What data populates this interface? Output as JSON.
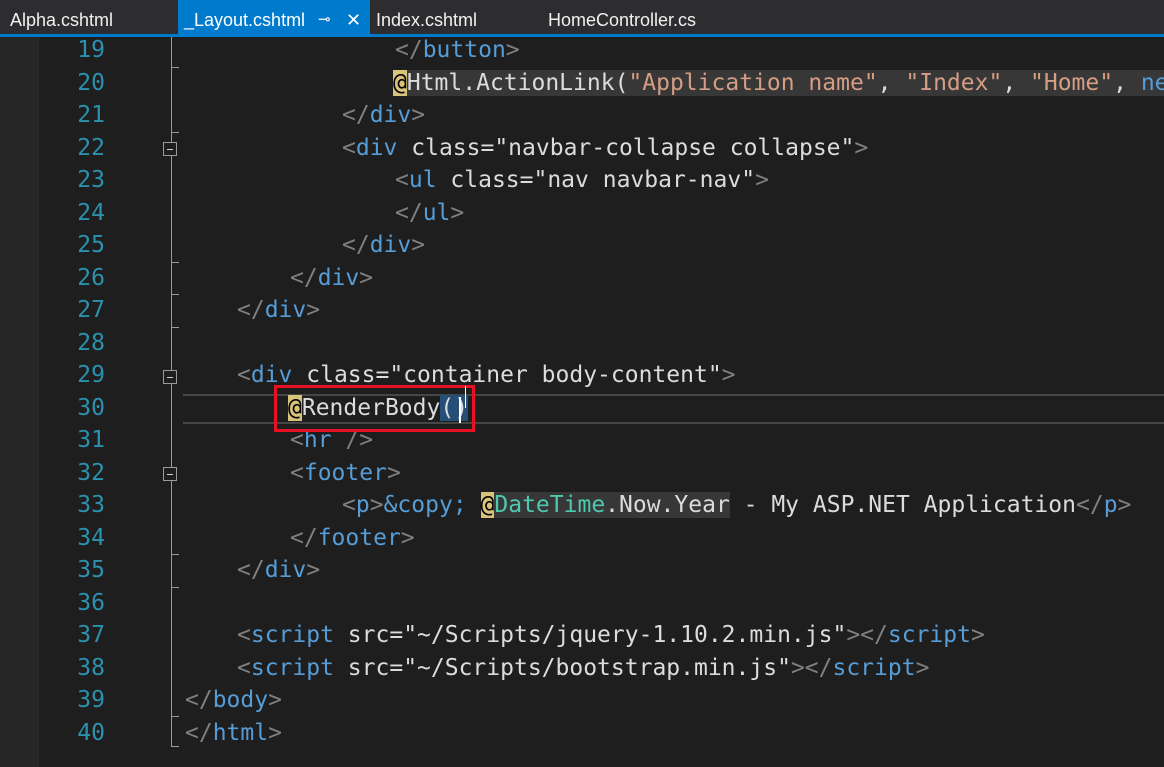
{
  "tabs": [
    {
      "name": "Alpha.cshtml",
      "active": false
    },
    {
      "name": "_Layout.cshtml",
      "active": true,
      "pin": "⊸",
      "close": "✕"
    },
    {
      "name": "Index.cshtml",
      "active": false
    },
    {
      "name": "HomeController.cs",
      "active": false
    }
  ],
  "editor": {
    "line_numbers": [
      "19",
      "20",
      "21",
      "22",
      "23",
      "24",
      "25",
      "26",
      "27",
      "28",
      "29",
      "30",
      "31",
      "32",
      "33",
      "34",
      "35",
      "36",
      "37",
      "38",
      "39",
      "40"
    ],
    "current_line": "30",
    "highlighted_code": "@RenderBody()",
    "lines": [
      {
        "n": "19",
        "tokens": [
          {
            "t": "</",
            "c": "delim"
          },
          {
            "t": "button",
            "c": "tag"
          },
          {
            "t": ">",
            "c": "delim"
          }
        ]
      },
      {
        "n": "20",
        "tokens": [
          {
            "t": "@",
            "c": "at"
          },
          {
            "t": "Html.ActionLink(",
            "c": "razor"
          },
          {
            "t": "\"Application name\"",
            "c": "str-razor"
          },
          {
            "t": ", ",
            "c": "razor"
          },
          {
            "t": "\"Index\"",
            "c": "str-razor"
          },
          {
            "t": ", ",
            "c": "razor"
          },
          {
            "t": "\"Home\"",
            "c": "str-razor"
          },
          {
            "t": ", ",
            "c": "razor"
          },
          {
            "t": "new {",
            "c": "kw-razor"
          }
        ]
      },
      {
        "n": "21",
        "tokens": [
          {
            "t": "</",
            "c": "delim"
          },
          {
            "t": "div",
            "c": "tag"
          },
          {
            "t": ">",
            "c": "delim"
          }
        ]
      },
      {
        "n": "22",
        "tokens": [
          {
            "t": "<",
            "c": "delim"
          },
          {
            "t": "div",
            "c": "tag"
          },
          {
            "t": " class=\"navbar-collapse collapse\"",
            "c": "text"
          },
          {
            "t": ">",
            "c": "delim"
          }
        ]
      },
      {
        "n": "23",
        "tokens": [
          {
            "t": "<",
            "c": "delim"
          },
          {
            "t": "ul",
            "c": "tag"
          },
          {
            "t": " class=\"nav navbar-nav\"",
            "c": "text"
          },
          {
            "t": ">",
            "c": "delim"
          }
        ]
      },
      {
        "n": "24",
        "tokens": [
          {
            "t": "</",
            "c": "delim"
          },
          {
            "t": "ul",
            "c": "tag"
          },
          {
            "t": ">",
            "c": "delim"
          }
        ]
      },
      {
        "n": "25",
        "tokens": [
          {
            "t": "</",
            "c": "delim"
          },
          {
            "t": "div",
            "c": "tag"
          },
          {
            "t": ">",
            "c": "delim"
          }
        ]
      },
      {
        "n": "26",
        "tokens": [
          {
            "t": "</",
            "c": "delim"
          },
          {
            "t": "div",
            "c": "tag"
          },
          {
            "t": ">",
            "c": "delim"
          }
        ]
      },
      {
        "n": "27",
        "tokens": [
          {
            "t": "</",
            "c": "delim"
          },
          {
            "t": "div",
            "c": "tag"
          },
          {
            "t": ">",
            "c": "delim"
          }
        ]
      },
      {
        "n": "28",
        "tokens": []
      },
      {
        "n": "29",
        "tokens": [
          {
            "t": "<",
            "c": "delim"
          },
          {
            "t": "div",
            "c": "tag"
          },
          {
            "t": " class=\"container body-content\"",
            "c": "text"
          },
          {
            "t": ">",
            "c": "delim"
          }
        ]
      },
      {
        "n": "30",
        "tokens": [
          {
            "t": "@",
            "c": "at"
          },
          {
            "t": "RenderBody",
            "c": "text"
          },
          {
            "t": "()",
            "c": "paren"
          }
        ]
      },
      {
        "n": "31",
        "tokens": [
          {
            "t": "<",
            "c": "delim"
          },
          {
            "t": "hr",
            "c": "tag"
          },
          {
            "t": " />",
            "c": "delim"
          }
        ]
      },
      {
        "n": "32",
        "tokens": [
          {
            "t": "<",
            "c": "delim"
          },
          {
            "t": "footer",
            "c": "tag"
          },
          {
            "t": ">",
            "c": "delim"
          }
        ]
      },
      {
        "n": "33",
        "tokens": [
          {
            "t": "<",
            "c": "delim"
          },
          {
            "t": "p",
            "c": "tag"
          },
          {
            "t": ">",
            "c": "delim"
          },
          {
            "t": "&copy;",
            "c": "tag"
          },
          {
            "t": " ",
            "c": "text"
          },
          {
            "t": "@",
            "c": "at"
          },
          {
            "t": "DateTime",
            "c": "type-razor"
          },
          {
            "t": ".Now.Year",
            "c": "razor"
          },
          {
            "t": " - My ASP.NET Application",
            "c": "text"
          },
          {
            "t": "</",
            "c": "delim"
          },
          {
            "t": "p",
            "c": "tag"
          },
          {
            "t": ">",
            "c": "delim"
          }
        ]
      },
      {
        "n": "34",
        "tokens": [
          {
            "t": "</",
            "c": "delim"
          },
          {
            "t": "footer",
            "c": "tag"
          },
          {
            "t": ">",
            "c": "delim"
          }
        ]
      },
      {
        "n": "35",
        "tokens": [
          {
            "t": "</",
            "c": "delim"
          },
          {
            "t": "div",
            "c": "tag"
          },
          {
            "t": ">",
            "c": "delim"
          }
        ]
      },
      {
        "n": "36",
        "tokens": []
      },
      {
        "n": "37",
        "tokens": [
          {
            "t": "<",
            "c": "delim"
          },
          {
            "t": "script",
            "c": "tag"
          },
          {
            "t": " src=\"~/Scripts/jquery-1.10.2.min.js\"",
            "c": "text"
          },
          {
            "t": "></",
            "c": "delim"
          },
          {
            "t": "script",
            "c": "tag"
          },
          {
            "t": ">",
            "c": "delim"
          }
        ]
      },
      {
        "n": "38",
        "tokens": [
          {
            "t": "<",
            "c": "delim"
          },
          {
            "t": "script",
            "c": "tag"
          },
          {
            "t": " src=\"~/Scripts/bootstrap.min.js\"",
            "c": "text"
          },
          {
            "t": "></",
            "c": "delim"
          },
          {
            "t": "script",
            "c": "tag"
          },
          {
            "t": ">",
            "c": "delim"
          }
        ]
      },
      {
        "n": "39",
        "tokens": [
          {
            "t": "</",
            "c": "delim"
          },
          {
            "t": "body",
            "c": "tag"
          },
          {
            "t": ">",
            "c": "delim"
          }
        ]
      },
      {
        "n": "40",
        "tokens": [
          {
            "t": "</",
            "c": "delim"
          },
          {
            "t": "html",
            "c": "tag"
          },
          {
            "t": ">",
            "c": "delim"
          }
        ]
      }
    ]
  },
  "colors": {
    "background": "#1e1e1e",
    "accent": "#007acc",
    "line_number": "#2b91af",
    "highlight_box": "#e81123"
  }
}
